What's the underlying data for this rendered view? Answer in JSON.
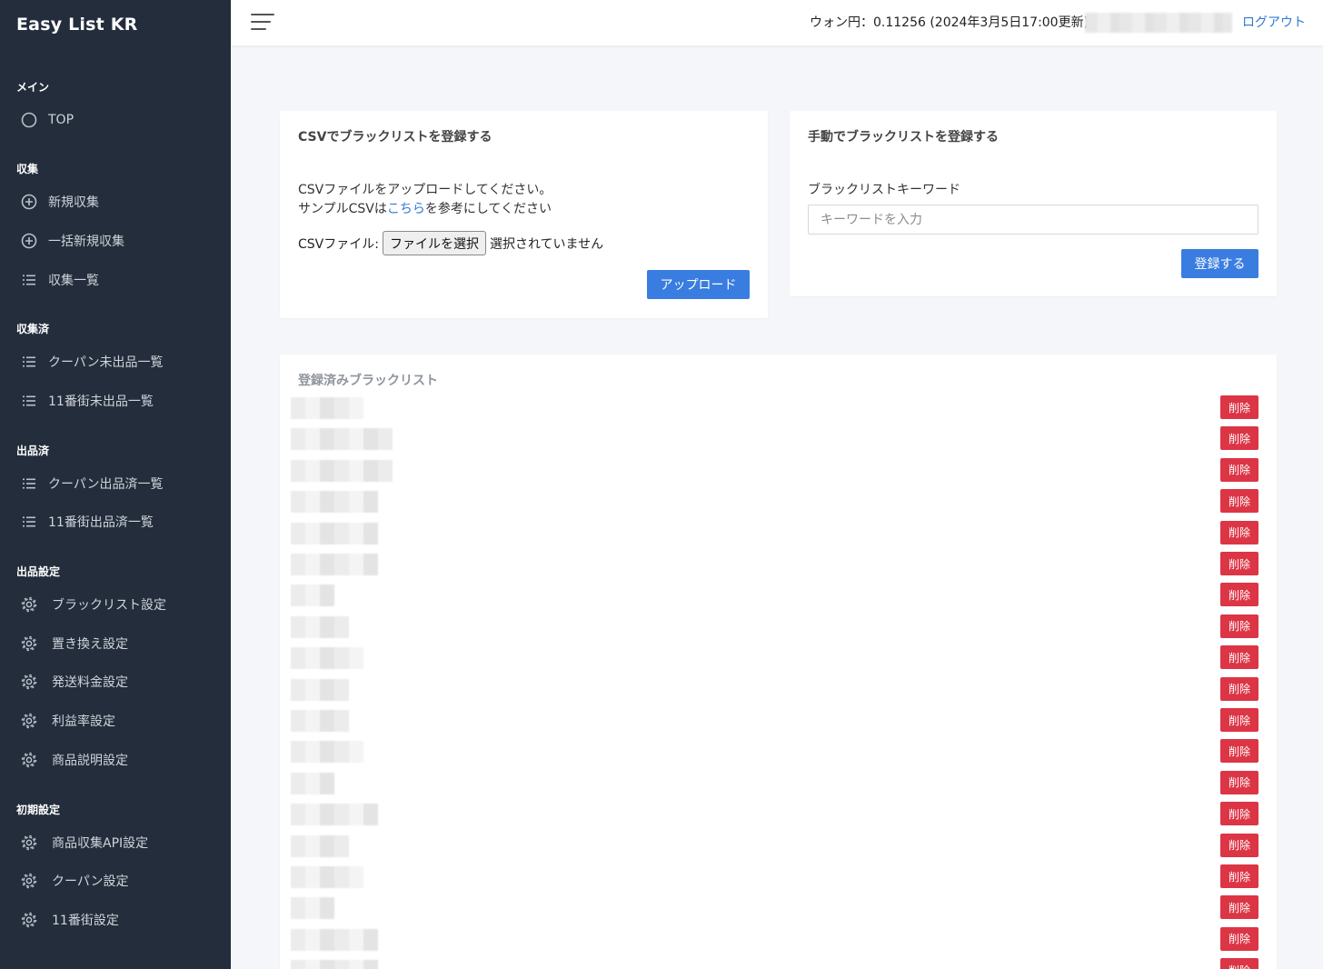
{
  "sidebar": {
    "brand": "Easy List KR",
    "sections": {
      "main": "メイン",
      "collect": "収集",
      "collected": "収集済",
      "listed": "出品済",
      "listing_settings": "出品設定",
      "initial_settings": "初期設定"
    },
    "items": {
      "top": "TOP",
      "new_collect": "新規収集",
      "bulk_collect": "一括新規収集",
      "collect_list": "収集一覧",
      "coupang_unlisted": "クーパン未出品一覧",
      "st11_unlisted": "11番街未出品一覧",
      "coupang_listed": "クーパン出品済一覧",
      "st11_listed": "11番街出品済一覧",
      "blacklist_settings": "ブラックリスト設定",
      "replace_settings": "置き換え設定",
      "shipping_fee_settings": "発送料金設定",
      "profit_rate_settings": "利益率設定",
      "description_settings": "商品説明設定",
      "api_settings": "商品収集API設定",
      "coupang_settings": "クーパン設定",
      "st11_settings": "11番街設定"
    }
  },
  "header": {
    "rate": "ウォン円：0.11256 (2024年3月5日17:00更新)",
    "logout": "ログアウト"
  },
  "csv_card": {
    "title": "CSVでブラックリストを登録する",
    "line1": "CSVファイルをアップロードしてください。",
    "line2_prefix": "サンプルCSVは",
    "line2_link": "こちら",
    "line2_suffix": "を参考にしてください",
    "file_label": "CSVファイル:",
    "file_button": "ファイルを選択",
    "file_status": "選択されていません",
    "upload_button": "アップロード"
  },
  "manual_card": {
    "title": "手動でブラックリストを登録する",
    "keyword_label": "ブラックリストキーワード",
    "keyword_placeholder": "キーワードを入力",
    "keyword_value": "",
    "register_button": "登録する"
  },
  "blacklist": {
    "title": "登録済みブラックリスト",
    "delete_label": "削除",
    "row_count": 19
  },
  "colors": {
    "sidebar_bg": "#232d3b",
    "primary": "#3a7de0",
    "danger": "#dc3545",
    "link": "#2f7ad6",
    "page_bg": "#f4f6f9"
  }
}
